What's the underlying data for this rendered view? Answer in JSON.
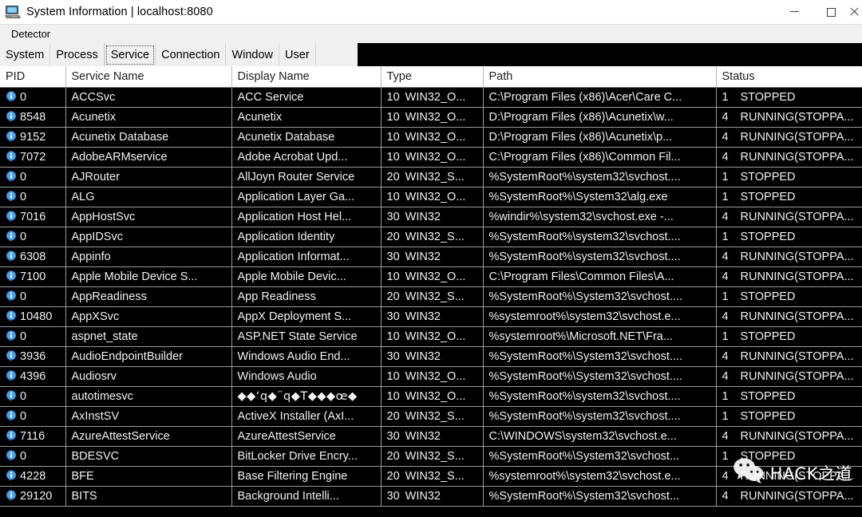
{
  "window": {
    "title": "System Information | localhost:8080",
    "icon": "computer-monitor-icon",
    "controls": {
      "minimize": "—",
      "maximize": "□",
      "close": "✕"
    }
  },
  "menubar": {
    "items": [
      {
        "label": "Detector"
      }
    ]
  },
  "tabs": {
    "items": [
      {
        "label": "System",
        "selected": false
      },
      {
        "label": "Process",
        "selected": false
      },
      {
        "label": "Service",
        "selected": true
      },
      {
        "label": "Connection",
        "selected": false
      },
      {
        "label": "Window",
        "selected": false
      },
      {
        "label": "User",
        "selected": false
      }
    ]
  },
  "table": {
    "columns": [
      "PID",
      "Service Name",
      "Display Name",
      "Type",
      "Path",
      "Status"
    ],
    "rows": [
      {
        "pid": "0",
        "service": "ACCSvc",
        "display": "ACC Service",
        "type_num": "10",
        "type_name": "WIN32_O...",
        "path": "C:\\Program Files (x86)\\Acer\\Care C...",
        "status_num": "1",
        "status_name": "STOPPED"
      },
      {
        "pid": "8548",
        "service": "Acunetix",
        "display": "Acunetix",
        "type_num": "10",
        "type_name": "WIN32_O...",
        "path": "D:\\Program Files (x86)\\Acunetix\\w...",
        "status_num": "4",
        "status_name": "RUNNING(STOPPA..."
      },
      {
        "pid": "9152",
        "service": "Acunetix Database",
        "display": "Acunetix Database",
        "type_num": "10",
        "type_name": "WIN32_O...",
        "path": "D:\\Program Files (x86)\\Acunetix\\p...",
        "status_num": "4",
        "status_name": "RUNNING(STOPPA..."
      },
      {
        "pid": "7072",
        "service": "AdobeARMservice",
        "display": "Adobe Acrobat Upd...",
        "type_num": "10",
        "type_name": "WIN32_O...",
        "path": "C:\\Program Files (x86)\\Common Fil...",
        "status_num": "4",
        "status_name": "RUNNING(STOPPA..."
      },
      {
        "pid": "0",
        "service": "AJRouter",
        "display": "AllJoyn Router Service",
        "type_num": "20",
        "type_name": "WIN32_S...",
        "path": "%SystemRoot%\\system32\\svchost....",
        "status_num": "1",
        "status_name": "STOPPED"
      },
      {
        "pid": "0",
        "service": "ALG",
        "display": "Application Layer Ga...",
        "type_num": "10",
        "type_name": "WIN32_O...",
        "path": "%SystemRoot%\\System32\\alg.exe",
        "status_num": "1",
        "status_name": "STOPPED"
      },
      {
        "pid": "7016",
        "service": "AppHostSvc",
        "display": "Application Host Hel...",
        "type_num": "30",
        "type_name": "WIN32",
        "path": "%windir%\\system32\\svchost.exe -...",
        "status_num": "4",
        "status_name": "RUNNING(STOPPA..."
      },
      {
        "pid": "0",
        "service": "AppIDSvc",
        "display": "Application Identity",
        "type_num": "20",
        "type_name": "WIN32_S...",
        "path": "%SystemRoot%\\system32\\svchost....",
        "status_num": "1",
        "status_name": "STOPPED"
      },
      {
        "pid": "6308",
        "service": "Appinfo",
        "display": "Application Informat...",
        "type_num": "30",
        "type_name": "WIN32",
        "path": "%SystemRoot%\\system32\\svchost....",
        "status_num": "4",
        "status_name": "RUNNING(STOPPA..."
      },
      {
        "pid": "7100",
        "service": "Apple Mobile Device S...",
        "display": "Apple Mobile Devic...",
        "type_num": "10",
        "type_name": "WIN32_O...",
        "path": "C:\\Program Files\\Common Files\\A...",
        "status_num": "4",
        "status_name": "RUNNING(STOPPA..."
      },
      {
        "pid": "0",
        "service": "AppReadiness",
        "display": "App Readiness",
        "type_num": "20",
        "type_name": "WIN32_S...",
        "path": "%SystemRoot%\\System32\\svchost....",
        "status_num": "1",
        "status_name": "STOPPED"
      },
      {
        "pid": "10480",
        "service": "AppXSvc",
        "display": "AppX Deployment S...",
        "type_num": "30",
        "type_name": "WIN32",
        "path": "%systemroot%\\system32\\svchost.e...",
        "status_num": "4",
        "status_name": "RUNNING(STOPPA..."
      },
      {
        "pid": "0",
        "service": "aspnet_state",
        "display": "ASP.NET State Service",
        "type_num": "10",
        "type_name": "WIN32_O...",
        "path": "%systemroot%\\Microsoft.NET\\Fra...",
        "status_num": "1",
        "status_name": "STOPPED"
      },
      {
        "pid": "3936",
        "service": "AudioEndpointBuilder",
        "display": "Windows Audio End...",
        "type_num": "30",
        "type_name": "WIN32",
        "path": "%SystemRoot%\\System32\\svchost....",
        "status_num": "4",
        "status_name": "RUNNING(STOPPA..."
      },
      {
        "pid": "4396",
        "service": "Audiosrv",
        "display": "Windows Audio",
        "type_num": "10",
        "type_name": "WIN32_O...",
        "path": "%SystemRoot%\\System32\\svchost....",
        "status_num": "4",
        "status_name": "RUNNING(STOPPA..."
      },
      {
        "pid": "0",
        "service": "autotimesvc",
        "display": "◆◆‘q◆¨q◆T◆◆◆œ◆",
        "type_num": "10",
        "type_name": "WIN32_O...",
        "path": "%SystemRoot%\\system32\\svchost....",
        "status_num": "1",
        "status_name": "STOPPED",
        "mojibake": true
      },
      {
        "pid": "0",
        "service": "AxInstSV",
        "display": "ActiveX Installer (AxI...",
        "type_num": "20",
        "type_name": "WIN32_S...",
        "path": "%SystemRoot%\\system32\\svchost....",
        "status_num": "1",
        "status_name": "STOPPED"
      },
      {
        "pid": "7116",
        "service": "AzureAttestService",
        "display": "AzureAttestService",
        "type_num": "30",
        "type_name": "WIN32",
        "path": "C:\\WINDOWS\\system32\\svchost.e...",
        "status_num": "4",
        "status_name": "RUNNING(STOPPA..."
      },
      {
        "pid": "0",
        "service": "BDESVC",
        "display": "BitLocker Drive Encry...",
        "type_num": "20",
        "type_name": "WIN32_S...",
        "path": "%SystemRoot%\\System32\\svchost...",
        "status_num": "1",
        "status_name": "STOPPED"
      },
      {
        "pid": "4228",
        "service": "BFE",
        "display": "Base Filtering Engine",
        "type_num": "20",
        "type_name": "WIN32_S...",
        "path": "%systemroot%\\system32\\svchost.e...",
        "status_num": "4",
        "status_name": "RUNNING(STOPPA..."
      },
      {
        "pid": "29120",
        "service": "BITS",
        "display": "Background Intelli...",
        "type_num": "30",
        "type_name": "WIN32",
        "path": "%SystemRoot%\\System32\\svchost...",
        "status_num": "4",
        "status_name": "RUNNING(STOPPA..."
      }
    ]
  },
  "watermark": {
    "text": "HACK之道",
    "logo": "wechat-logo"
  }
}
